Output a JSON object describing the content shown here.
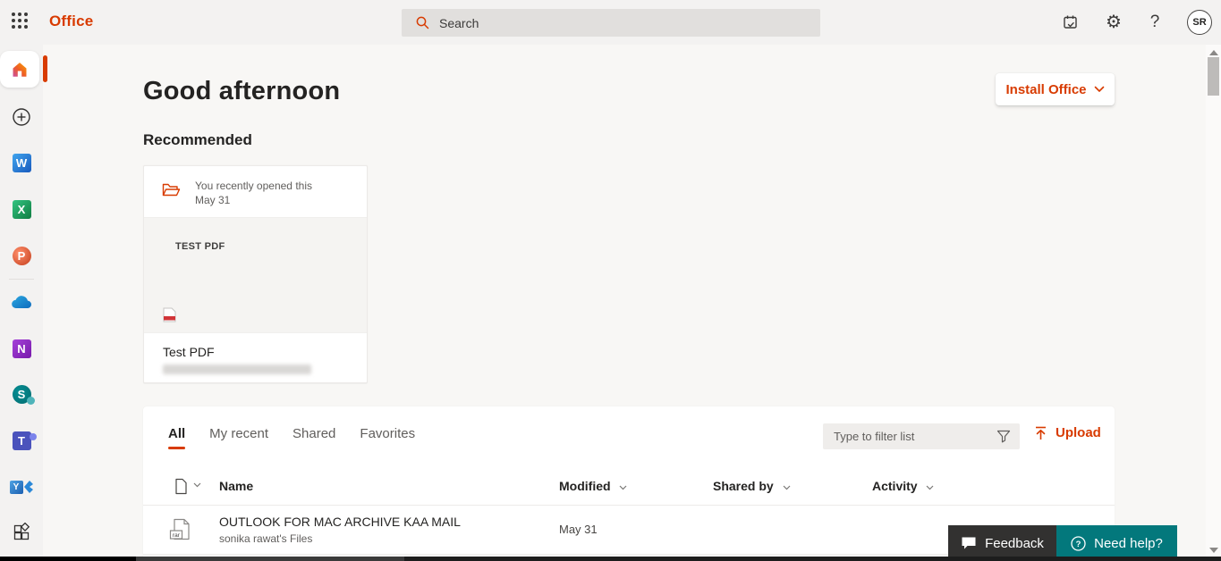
{
  "topbar": {
    "app_name": "Office",
    "search_placeholder": "Search",
    "avatar_initials": "SR"
  },
  "sidebar": {
    "app_letters": {
      "word": "W",
      "excel": "X",
      "powerpoint": "P",
      "onenote": "N",
      "sharepoint": "S",
      "teams": "T",
      "yammer": "Y"
    }
  },
  "main": {
    "greeting": "Good afternoon",
    "install_button_label": "Install Office",
    "recommended": {
      "heading": "Recommended",
      "card": {
        "activity_line1": "You recently opened this",
        "activity_line2": "May 31",
        "thumbnail_text": "TEST PDF",
        "title": "Test PDF"
      }
    },
    "files": {
      "tabs": [
        "All",
        "My recent",
        "Shared",
        "Favorites"
      ],
      "active_tab": "All",
      "filter_placeholder": "Type to filter list",
      "upload_label": "Upload",
      "columns": [
        "Name",
        "Modified",
        "Shared by",
        "Activity"
      ],
      "rows": [
        {
          "file_type_label": "rar",
          "name": "OUTLOOK FOR MAC ARCHIVE KAA MAIL",
          "subtitle": "sonika rawat's Files",
          "modified": "May 31"
        }
      ]
    }
  },
  "footer": {
    "feedback_label": "Feedback",
    "need_help_label": "Need help?"
  },
  "colors": {
    "brand_orange": "#d83b01",
    "topbar_bg": "#f3f2f1",
    "page_bg": "#f8f7f5",
    "feedback_bg": "#323130",
    "need_help_bg": "#03787c",
    "tab_underline": "#d83b01"
  }
}
